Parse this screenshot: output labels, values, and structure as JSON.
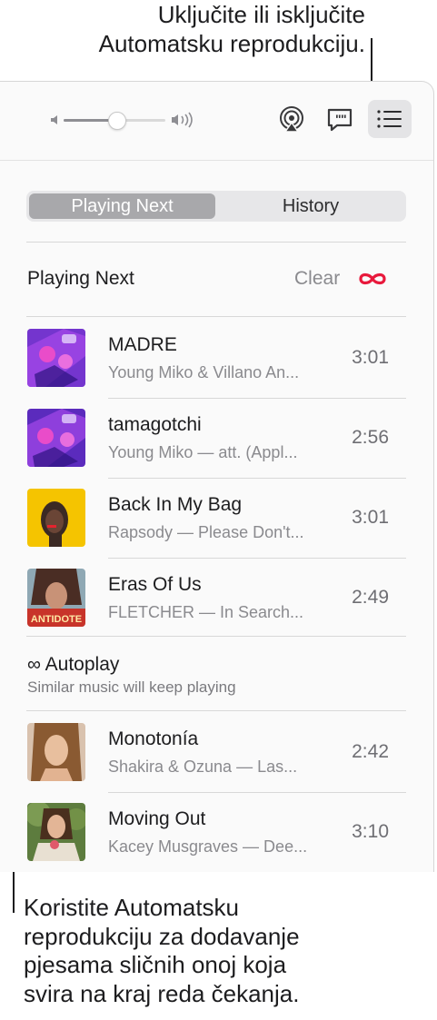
{
  "callouts": {
    "top": [
      "Uključite ili isključite",
      "Automatsku reprodukciju."
    ],
    "bottom": [
      "Koristite Automatsku",
      "reprodukciju za dodavanje",
      "pjesama sličnih onoj koja",
      "svira na kraj reda čekanja."
    ]
  },
  "toolbar": {
    "volume_level": 0.52,
    "icons": [
      "speaker-low-icon",
      "speaker-high-icon",
      "airplay-icon",
      "lyrics-icon",
      "queue-list-icon"
    ]
  },
  "segmented": {
    "selected": "Playing Next",
    "tabs": [
      "Playing Next",
      "History"
    ]
  },
  "playing_next": {
    "title": "Playing Next",
    "clear_label": "Clear",
    "autoplay_symbol": "∞"
  },
  "tracks": [
    {
      "title": "MADRE",
      "subtitle": "Young Miko & Villano An...",
      "duration": "3:01"
    },
    {
      "title": "tamagotchi",
      "subtitle": "Young Miko — att. (Appl...",
      "duration": "2:56"
    },
    {
      "title": "Back In My Bag",
      "subtitle": "Rapsody — Please Don't...",
      "duration": "3:01"
    },
    {
      "title": "Eras Of Us",
      "subtitle": "FLETCHER — In Search...",
      "duration": "2:49",
      "art_text": "ANTIDOTE"
    }
  ],
  "autoplay": {
    "title": "∞ Autoplay",
    "subtitle": "Similar music will keep playing",
    "tracks": [
      {
        "title": "Monotonía",
        "subtitle": "Shakira & Ozuna — Las...",
        "duration": "2:42"
      },
      {
        "title": "Moving Out",
        "subtitle": "Kacey Musgraves — Dee...",
        "duration": "3:10"
      }
    ]
  },
  "colors": {
    "accent_red": "#e8193c",
    "segment_selected": "#a8a8ab"
  }
}
